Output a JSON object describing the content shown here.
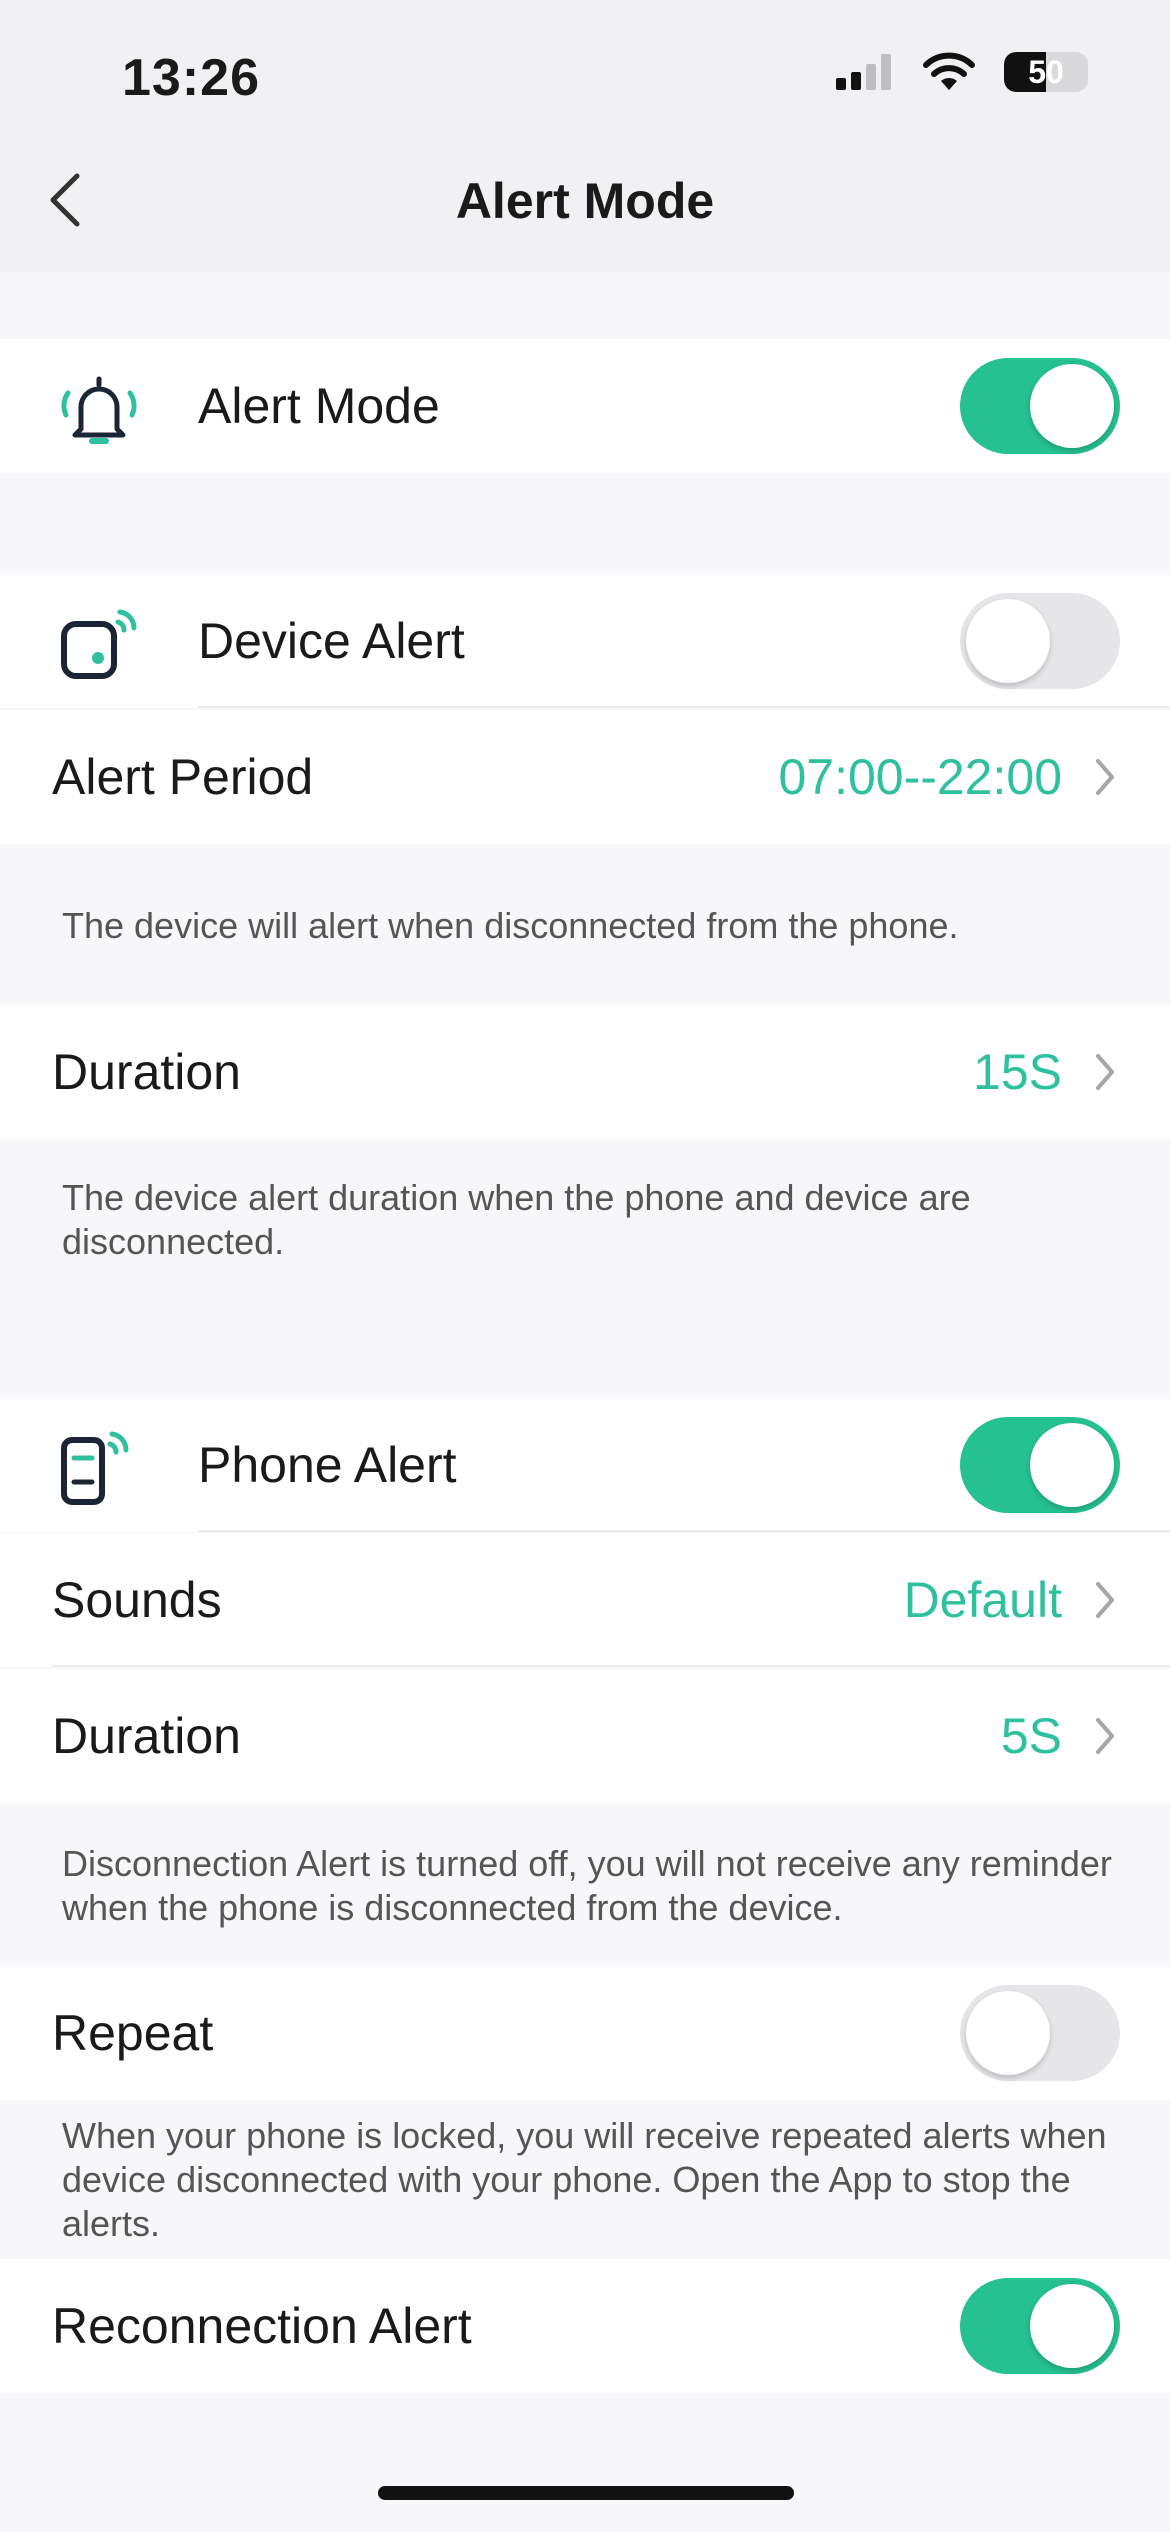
{
  "status_bar": {
    "time": "13:26",
    "battery_percent": "50"
  },
  "nav": {
    "title": "Alert Mode"
  },
  "alert_mode": {
    "label": "Alert Mode",
    "enabled": true
  },
  "device_alert": {
    "label": "Device Alert",
    "enabled": false,
    "period_label": "Alert Period",
    "period_value": "07:00--22:00",
    "period_note": "The device will alert when disconnected from the phone.",
    "duration_label": "Duration",
    "duration_value": "15S",
    "duration_note": "The device alert duration when the phone and device are disconnected."
  },
  "phone_alert": {
    "label": "Phone Alert",
    "enabled": true,
    "sounds_label": "Sounds",
    "sounds_value": "Default",
    "duration_label": "Duration",
    "duration_value": "5S",
    "note": "Disconnection Alert is turned off, you will not receive any reminder when the phone is disconnected from the device."
  },
  "repeat": {
    "label": "Repeat",
    "enabled": false,
    "note": "When your phone is locked, you will receive repeated alerts when device disconnected with your phone. Open the App to stop the alerts."
  },
  "reconnection_alert": {
    "label": "Reconnection Alert",
    "enabled": true
  },
  "colors": {
    "accent": "#2fc0a0",
    "toggle_on": "#26c190",
    "icon_dark": "#1c2535"
  }
}
